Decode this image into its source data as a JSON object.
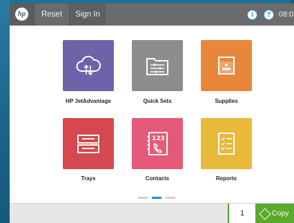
{
  "topbar": {
    "logo_text": "hp",
    "reset_label": "Reset",
    "signin_label": "Sign In",
    "info_glyph": "i",
    "help_glyph": "?",
    "clock": "08:0"
  },
  "tiles": [
    {
      "label": "HP JetAdvantage",
      "color": "#6f62a8",
      "icon": "cloud-icon"
    },
    {
      "label": "Quick Sets",
      "color": "#8d8d8d",
      "icon": "folder-settings-icon"
    },
    {
      "label": "Supplies",
      "color": "#e8873a",
      "icon": "toner-icon"
    },
    {
      "label": "Trays",
      "color": "#d6474f",
      "icon": "tray-icon"
    },
    {
      "label": "Contacts",
      "color": "#e45a78",
      "icon": "contacts-icon"
    },
    {
      "label": "Reports",
      "color": "#e8b93a",
      "icon": "report-icon"
    }
  ],
  "tile_glyph_text": {
    "contacts_number": "123"
  },
  "pagination": {
    "pages": 3,
    "active": 2
  },
  "bottombar": {
    "copies": "1",
    "copy_label": "Copy"
  }
}
